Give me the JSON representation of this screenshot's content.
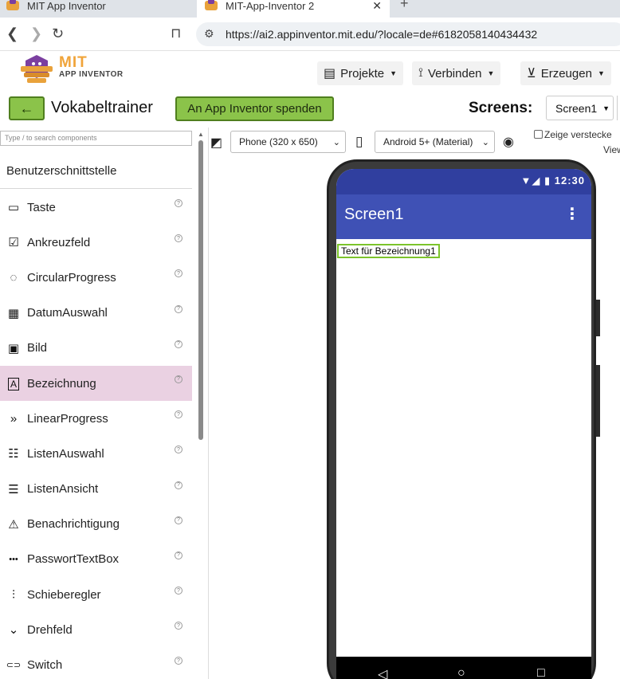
{
  "browser": {
    "tabs": [
      {
        "title": "MIT App Inventor",
        "active": false
      },
      {
        "title": "MIT-App-Inventor 2",
        "active": true
      }
    ],
    "tab_close": "✕",
    "new_tab": "+",
    "url": "https://ai2.appinventor.mit.edu/?locale=de#6182058140434432"
  },
  "header": {
    "logo_title": "MIT",
    "logo_subtitle": "APP INVENTOR",
    "menus": [
      {
        "label": "Projekte",
        "icon": "folder-icon"
      },
      {
        "label": "Verbinden",
        "icon": "connect-icon"
      },
      {
        "label": "Erzeugen",
        "icon": "download-icon"
      }
    ]
  },
  "project": {
    "back_label": "←",
    "name": "Vokabeltrainer",
    "donate_label": "An App Inventor spenden",
    "screens_label": "Screens:",
    "screen_selected": "Screen1"
  },
  "palette": {
    "search_placeholder": "Type / to search components",
    "category": "Benutzerschnittstelle",
    "help_glyph": "?",
    "items": [
      {
        "label": "Taste",
        "icon": "button-icon",
        "glyph": "▭"
      },
      {
        "label": "Ankreuzfeld",
        "icon": "checkbox-icon",
        "glyph": "☑"
      },
      {
        "label": "CircularProgress",
        "icon": "circular-progress-icon",
        "glyph": "◌"
      },
      {
        "label": "DatumAuswahl",
        "icon": "calendar-icon",
        "glyph": "▦"
      },
      {
        "label": "Bild",
        "icon": "image-icon",
        "glyph": "▣"
      },
      {
        "label": "Bezeichnung",
        "icon": "label-icon",
        "glyph": "A",
        "selected": true
      },
      {
        "label": "LinearProgress",
        "icon": "linear-progress-icon",
        "glyph": "»"
      },
      {
        "label": "ListenAuswahl",
        "icon": "list-picker-icon",
        "glyph": "☷"
      },
      {
        "label": "ListenAnsicht",
        "icon": "list-view-icon",
        "glyph": "☰"
      },
      {
        "label": "Benachrichtigung",
        "icon": "warning-icon",
        "glyph": "⚠"
      },
      {
        "label": "PasswortTextBox",
        "icon": "password-icon",
        "glyph": "•••"
      },
      {
        "label": "Schieberegler",
        "icon": "slider-icon",
        "glyph": "⫶"
      },
      {
        "label": "Drehfeld",
        "icon": "spinner-icon",
        "glyph": "⌄"
      },
      {
        "label": "Switch",
        "icon": "switch-icon",
        "glyph": "⊂⊃"
      }
    ]
  },
  "viewer": {
    "phone_size": "Phone (320 x 650)",
    "theme": "Android 5+ (Material)",
    "hidden_components_label": "Zeige verstecke",
    "hidden_components_label_2": "View"
  },
  "phone": {
    "time": "12:30",
    "app_title": "Screen1",
    "label_text": "Text für Bezeichnung1",
    "nav_back": "◁",
    "nav_home": "○",
    "nav_recent": "□"
  },
  "colors": {
    "accent_green": "#8bc34a",
    "selected_item": "#ead1e2",
    "appbar": "#3f51b5",
    "statusbar": "#303f9f"
  }
}
